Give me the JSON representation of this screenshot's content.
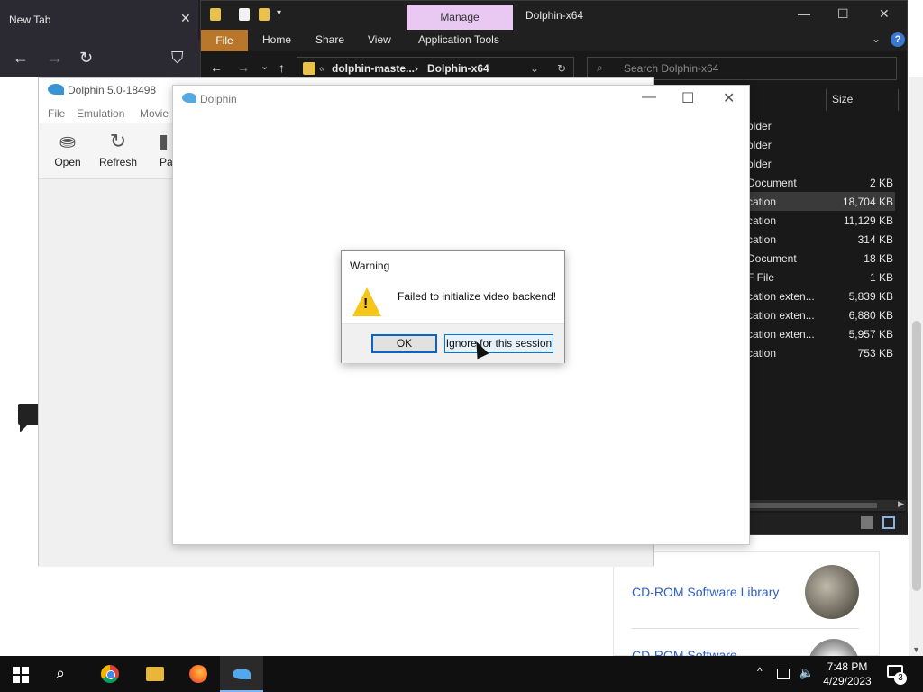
{
  "browser": {
    "tab_title": "New Tab",
    "tab_close": "✕",
    "back": "←",
    "forward": "→",
    "reload": "↻",
    "shield": "⛉",
    "card": {
      "link1": "CD-ROM Software Library",
      "link2": "CD-ROM Software"
    }
  },
  "explorer": {
    "manage_tab": "Manage",
    "window_title": "Dolphin-x64",
    "controls": {
      "minimize": "—",
      "maximize": "☐",
      "close": "✕"
    },
    "ribbon": {
      "file": "File",
      "home": "Home",
      "share": "Share",
      "view": "View",
      "app_tools": "Application Tools",
      "chevron": "⌄",
      "help": "?"
    },
    "nav": {
      "back": "←",
      "forward": "→",
      "recent": "⌄",
      "up": "↑",
      "refresh": "↻",
      "addr_overflow": "«",
      "addr_sep": "›",
      "addr_dropdown": "⌄"
    },
    "breadcrumb": [
      "dolphin-maste...",
      "Dolphin-x64"
    ],
    "search_placeholder": "Search Dolphin-x64",
    "columns": {
      "size": "Size"
    },
    "rows": [
      {
        "type": "older",
        "size": ""
      },
      {
        "type": "older",
        "size": ""
      },
      {
        "type": "older",
        "size": ""
      },
      {
        "type": "Document",
        "size": "2 KB"
      },
      {
        "type": "cation",
        "size": "18,704 KB"
      },
      {
        "type": "cation",
        "size": "11,129 KB"
      },
      {
        "type": "cation",
        "size": "314 KB"
      },
      {
        "type": "Document",
        "size": "18 KB"
      },
      {
        "type": "F File",
        "size": "1 KB"
      },
      {
        "type": "cation exten...",
        "size": "5,839 KB"
      },
      {
        "type": "cation exten...",
        "size": "6,880 KB"
      },
      {
        "type": "cation exten...",
        "size": "5,957 KB"
      },
      {
        "type": "cation",
        "size": "753 KB"
      }
    ]
  },
  "dolphin_main": {
    "title": "Dolphin 5.0-18498",
    "menu": {
      "file": "File",
      "emulation": "Emulation",
      "movie": "Movie"
    },
    "toolbar": {
      "open": "Open",
      "refresh": "Refresh",
      "pause": "Pa",
      "open_icon": "⛂",
      "refresh_icon": "↻",
      "pause_icon": "▮"
    }
  },
  "dolphin_render": {
    "title": "Dolphin",
    "controls": {
      "minimize": "—",
      "maximize": "☐",
      "close": "✕"
    }
  },
  "warning": {
    "title": "Warning",
    "message": "Failed to initialize video backend!",
    "icon_glyph": "!",
    "ok": "OK",
    "ignore": "Ignore for this session"
  },
  "taskbar": {
    "search_glyph": "⌕",
    "time": "7:48 PM",
    "date": "4/29/2023",
    "tray_up": "^",
    "notifications": "3"
  }
}
